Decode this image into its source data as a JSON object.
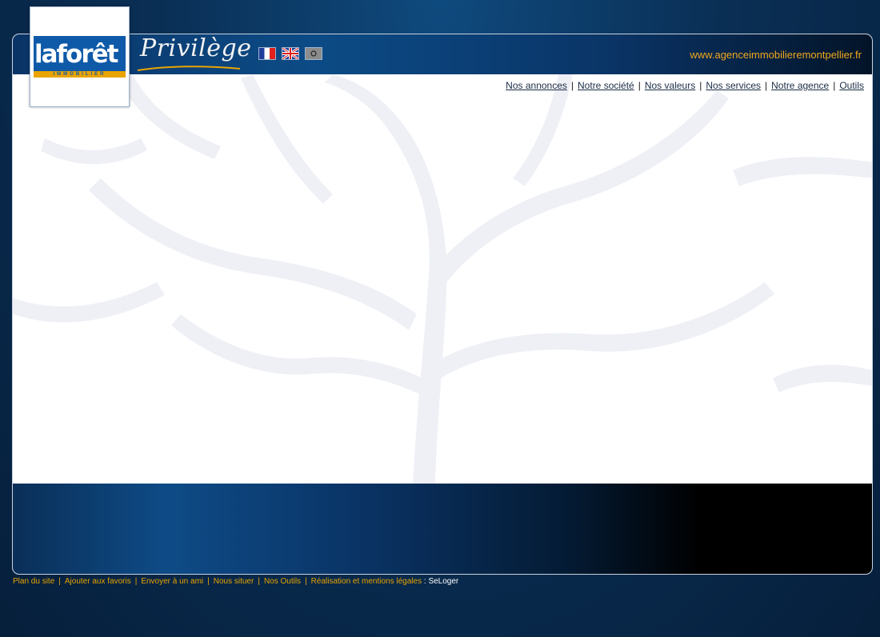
{
  "brand": {
    "logo_text": "laforêt",
    "logo_subtext": "IMMOBILIER",
    "tagline": "Privilège",
    "site_url": "www.agenceimmobilieremontpellier.fr"
  },
  "languages": [
    {
      "code": "fr",
      "icon": "france-flag-icon"
    },
    {
      "code": "en",
      "icon": "uk-flag-icon"
    },
    {
      "code": "other",
      "icon": "flag-icon"
    }
  ],
  "nav": {
    "items": [
      "Nos annonces",
      "Notre société",
      "Nos valeurs",
      "Nos services",
      "Notre agence",
      "Outils"
    ],
    "separator": "|"
  },
  "footer": {
    "links": [
      "Plan du site",
      "Ajouter aux favoris",
      "Envoyer à un ami",
      "Nous situer",
      "Nos Outils",
      "Réalisation et mentions légales"
    ],
    "separator": "|",
    "credit_prefix": " : ",
    "credit": "SeLoger"
  },
  "colors": {
    "accent": "#e9a400",
    "navy": "#0a3466",
    "link": "#1b2d45"
  }
}
